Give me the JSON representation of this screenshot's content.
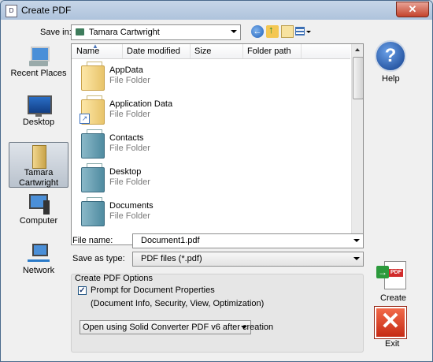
{
  "window": {
    "title": "Create PDF",
    "close_glyph": "✕",
    "title_icon_glyph": "D"
  },
  "toolbar": {
    "save_in_label": "Save in:",
    "save_in_value": "Tamara Cartwright",
    "back_glyph": "←"
  },
  "places": [
    {
      "label": "Recent Places",
      "icon": "recent-places-icon"
    },
    {
      "label": "Desktop",
      "icon": "desktop-icon"
    },
    {
      "label": "Tamara Cartwright",
      "icon": "user-folder-icon",
      "selected": true
    },
    {
      "label": "Computer",
      "icon": "computer-icon"
    },
    {
      "label": "Network",
      "icon": "network-icon"
    }
  ],
  "columns": [
    "Name",
    "Date modified",
    "Size",
    "Folder path"
  ],
  "files": [
    {
      "name": "AppData",
      "type": "File Folder"
    },
    {
      "name": "Application Data",
      "type": "File Folder",
      "shortcut": true
    },
    {
      "name": "Contacts",
      "type": "File Folder"
    },
    {
      "name": "Desktop",
      "type": "File Folder"
    },
    {
      "name": "Documents",
      "type": "File Folder"
    }
  ],
  "form": {
    "file_name_label": "File name:",
    "file_name_value": "Document1.pdf",
    "save_as_label": "Save as type:",
    "save_as_value": "PDF files (*.pdf)"
  },
  "options": {
    "group_title": "Create PDF Options",
    "prompt_label": "Prompt for Document Properties",
    "prompt_checked": true,
    "prompt_sub": "(Document Info, Security, View, Optimization)",
    "open_using_value": "Open using Solid Converter PDF v6 after creation"
  },
  "buttons": {
    "help": "Help",
    "create": "Create",
    "exit": "Exit",
    "help_glyph": "?",
    "exit_glyph": "✕",
    "pdf_mark": "PDF",
    "go_glyph": "→",
    "shortcut_glyph": "↗"
  },
  "colors": {
    "accent": "#123f8c",
    "exit_red": "#c52a14",
    "create_green": "#2c9a3c"
  }
}
